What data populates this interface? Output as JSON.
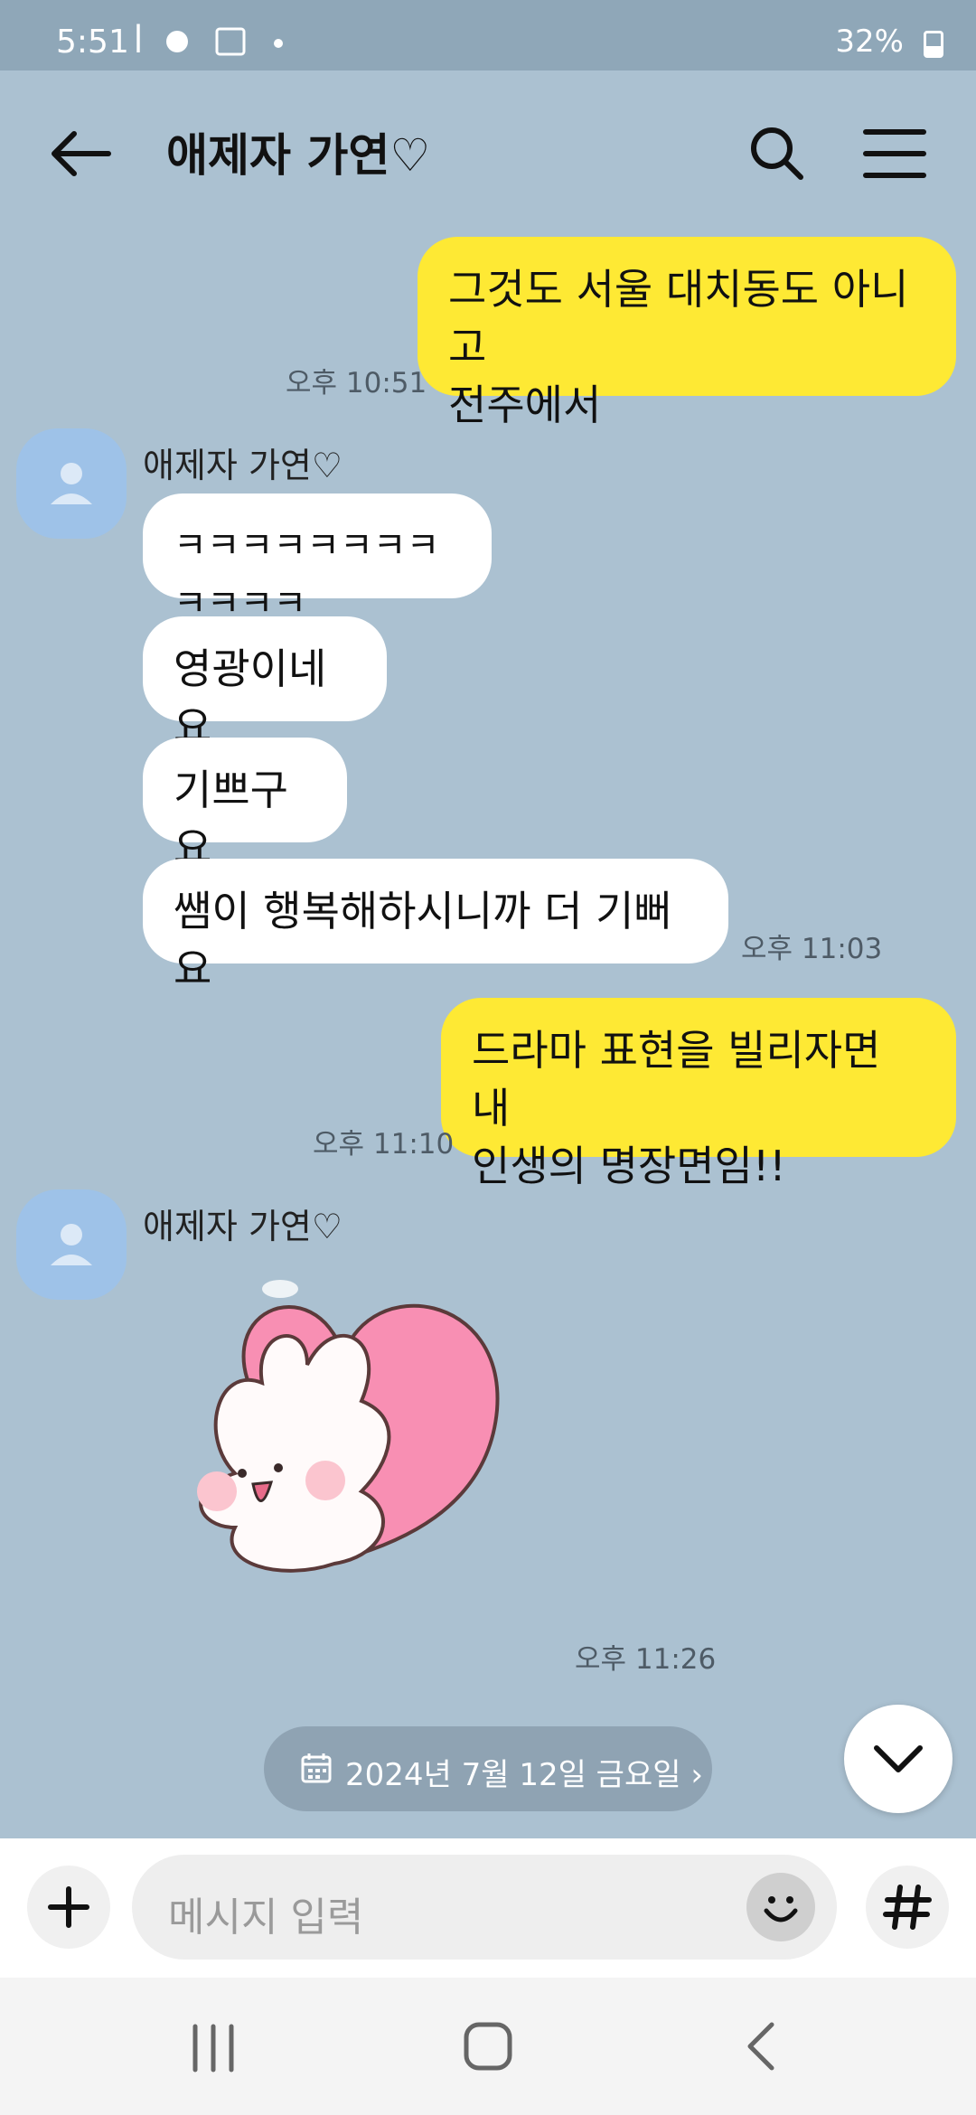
{
  "status_bar": {
    "time": "5:51",
    "battery": "32%"
  },
  "header": {
    "title": "애제자 가연♡"
  },
  "messages": [
    {
      "text": "그것도 서울 대치동도 아니고\n전주에서",
      "time": "오후 10:51",
      "direction": "outgoing"
    },
    {
      "sender": "애제자 가연♡",
      "text": "ㅋㅋㅋㅋㅋㅋㅋㅋㅋㅋㅋㅋ",
      "direction": "incoming"
    },
    {
      "text": "영광이네요",
      "direction": "incoming"
    },
    {
      "text": "기쁘구요",
      "direction": "incoming"
    },
    {
      "text": "쌤이 행복해하시니까 더 기뻐요",
      "time": "오후 11:03",
      "direction": "incoming"
    },
    {
      "text": "드라마 표현을 빌리자면 내\n인생의 명장면임!!",
      "time": "오후 11:10",
      "direction": "outgoing"
    },
    {
      "sender": "애제자 가연♡",
      "sticker": "bunny-heart-sticker",
      "time": "오후 11:26",
      "direction": "incoming"
    }
  ],
  "date_pill": "2024년 7월 12일 금요일 ›",
  "input": {
    "placeholder": "메시지 입력"
  },
  "colors": {
    "background": "#abc1d1",
    "outgoing_bubble": "#fee934",
    "incoming_bubble": "#ffffff"
  },
  "icons": [
    "back-arrow-icon",
    "search-icon",
    "menu-icon",
    "person-icon",
    "calendar-icon",
    "chevron-down-icon",
    "plus-icon",
    "emoji-icon",
    "hash-icon",
    "nav-recents-icon",
    "nav-home-icon",
    "nav-back-icon"
  ]
}
